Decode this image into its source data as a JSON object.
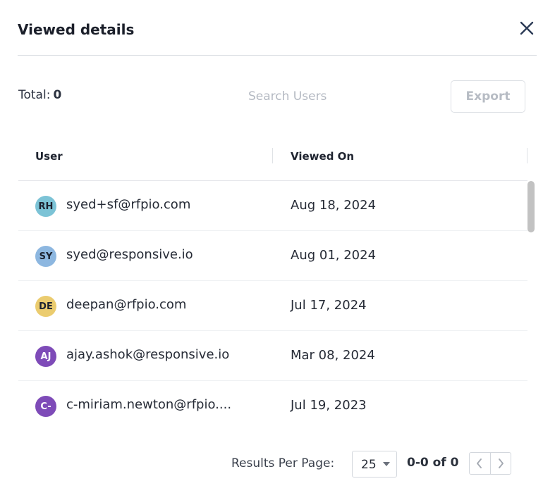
{
  "header": {
    "title": "Viewed details",
    "close_icon": "close-icon"
  },
  "toolbar": {
    "total_label": "Total:",
    "total_value": "0",
    "search_placeholder": "Search Users",
    "export_label": "Export"
  },
  "table": {
    "columns": [
      "User",
      "Viewed On"
    ],
    "rows": [
      {
        "initials": "RH",
        "avatar_color": "#7cc3d6",
        "email": "syed+sf@rfpio.com",
        "viewed_on": "Aug 18, 2024"
      },
      {
        "initials": "SY",
        "avatar_color": "#8db7e0",
        "email": "syed@responsive.io",
        "viewed_on": "Aug 01, 2024"
      },
      {
        "initials": "DE",
        "avatar_color": "#ebcc6f",
        "email": "deepan@rfpio.com",
        "viewed_on": "Jul 17, 2024"
      },
      {
        "initials": "AJ",
        "avatar_color": "#7e4bb8",
        "email": "ajay.ashok@responsive.io",
        "viewed_on": "Mar 08, 2024"
      },
      {
        "initials": "C-",
        "avatar_color": "#7e4bb8",
        "email": "c-miriam.newton@rfpio....",
        "viewed_on": "Jul 19, 2023"
      }
    ]
  },
  "pagination": {
    "results_per_page_label": "Results Per Page:",
    "results_per_page_value": "25",
    "range_text": "0-0 of 0"
  }
}
